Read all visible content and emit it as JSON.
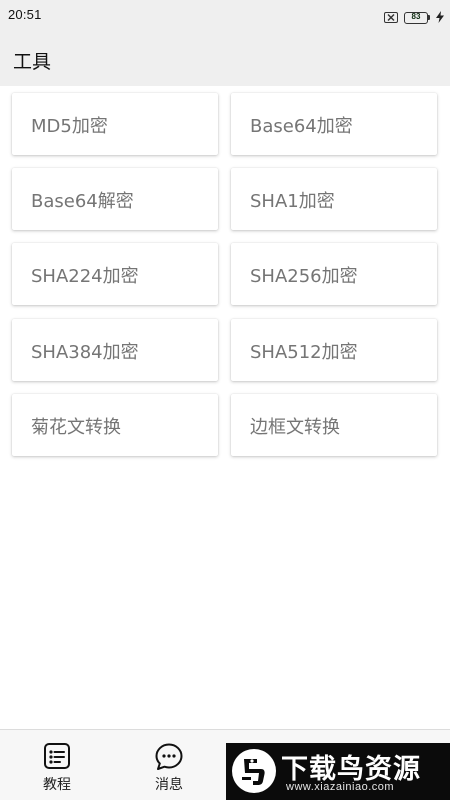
{
  "status_bar": {
    "time": "20:51",
    "battery_level": "83",
    "battery_fraction": 0.83,
    "icons": [
      "sim-off-icon",
      "battery-icon",
      "charging-bolt-icon"
    ]
  },
  "header": {
    "title": "工具"
  },
  "tools": [
    {
      "label": "MD5加密"
    },
    {
      "label": "Base64加密"
    },
    {
      "label": "Base64解密"
    },
    {
      "label": "SHA1加密"
    },
    {
      "label": "SHA224加密"
    },
    {
      "label": "SHA256加密"
    },
    {
      "label": "SHA384加密"
    },
    {
      "label": "SHA512加密"
    },
    {
      "label": "菊花文转换"
    },
    {
      "label": "边框文转换"
    }
  ],
  "bottom_nav": {
    "items": [
      {
        "label": "教程",
        "icon": "tutorial-list-icon"
      },
      {
        "label": "消息",
        "icon": "chat-bubble-icon"
      }
    ]
  },
  "watermark": {
    "title": "下载鸟资源",
    "url": "www.xiazainiao.com"
  },
  "colors": {
    "header_bg": "#efefef",
    "card_text": "#757575",
    "battery_fill": "#4caf50",
    "tools_accent": "#9c27b0"
  }
}
